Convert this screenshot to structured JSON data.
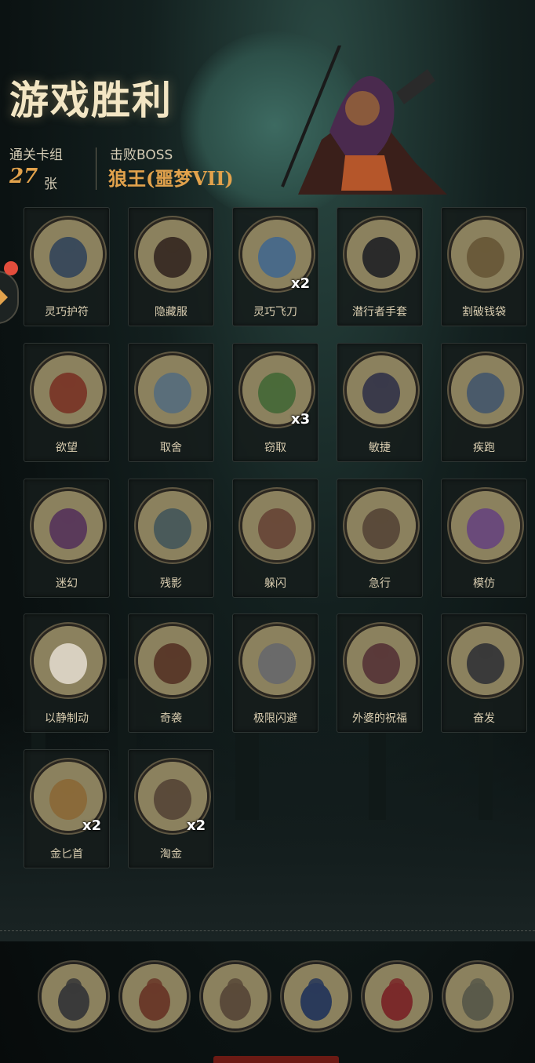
{
  "title": "游戏胜利",
  "stats": {
    "deck_label": "通关卡组",
    "deck_count": "27",
    "deck_unit": "张",
    "boss_label": "击败BOSS",
    "boss_name": "狼王(噩梦VII)"
  },
  "cards": [
    {
      "name": "灵巧护符",
      "count": "",
      "icon": "amulet-icon"
    },
    {
      "name": "隐藏服",
      "count": "",
      "icon": "hooded-cloak-icon"
    },
    {
      "name": "灵巧飞刀",
      "count": "x2",
      "icon": "throwing-knives-icon"
    },
    {
      "name": "潜行者手套",
      "count": "",
      "icon": "glove-icon"
    },
    {
      "name": "割破钱袋",
      "count": "",
      "icon": "cut-purse-icon"
    },
    {
      "name": "欲望",
      "count": "",
      "icon": "greedy-frog-icon"
    },
    {
      "name": "取舍",
      "count": "",
      "icon": "wizard-icon"
    },
    {
      "name": "窃取",
      "count": "x3",
      "icon": "goblin-thief-icon"
    },
    {
      "name": "敏捷",
      "count": "",
      "icon": "lightning-cat-icon"
    },
    {
      "name": "疾跑",
      "count": "",
      "icon": "running-goblin-icon"
    },
    {
      "name": "迷幻",
      "count": "",
      "icon": "witch-icon"
    },
    {
      "name": "残影",
      "count": "",
      "icon": "afterimage-icon"
    },
    {
      "name": "躲闪",
      "count": "",
      "icon": "dodge-icon"
    },
    {
      "name": "急行",
      "count": "",
      "icon": "dash-icon"
    },
    {
      "name": "模仿",
      "count": "",
      "icon": "mask-icon"
    },
    {
      "name": "以静制动",
      "count": "",
      "icon": "skull-flame-icon"
    },
    {
      "name": "奇袭",
      "count": "",
      "icon": "ambush-icon"
    },
    {
      "name": "极限闪避",
      "count": "",
      "icon": "extreme-dodge-icon"
    },
    {
      "name": "外婆的祝福",
      "count": "",
      "icon": "grandma-icon"
    },
    {
      "name": "奋发",
      "count": "",
      "icon": "muscle-kid-icon"
    },
    {
      "name": "金匕首",
      "count": "x2",
      "icon": "gold-dagger-icon"
    },
    {
      "name": "淘金",
      "count": "x2",
      "icon": "gold-pan-icon"
    }
  ],
  "heroes": [
    {
      "icon": "campfire-hero-icon"
    },
    {
      "icon": "archer-hero-icon"
    },
    {
      "icon": "helmet-hero-icon"
    },
    {
      "icon": "spellbook-icon"
    },
    {
      "icon": "demon-hero-icon"
    },
    {
      "icon": "warrior-hero-icon"
    }
  ],
  "colors": {
    "accent": "#e2a24c",
    "notification": "#e24d3c",
    "card_bg": "#161c1b",
    "portrait_bg": "#8b815e"
  }
}
